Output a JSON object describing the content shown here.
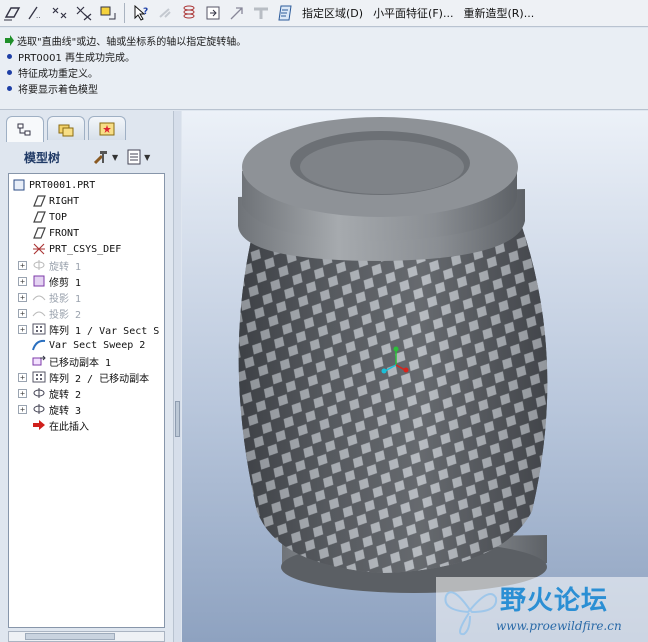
{
  "toolbar": {
    "icons": [
      "sketch-plane-icon",
      "sketch-line-icon",
      "sketch-points-icon",
      "sketch-axes-icon",
      "sketch-fit-icon",
      "help-pointer-icon",
      "disabled-tool-icon",
      "spring-feature-icon",
      "insert-icon",
      "arrow-tool-icon",
      "flat-tool-icon",
      "document-edit-icon"
    ],
    "commands": [
      "指定区域(D)",
      "小平面特征(F)...",
      "重新造型(R)..."
    ]
  },
  "messages": [
    {
      "type": "prompt",
      "text": "选取\"直曲线\"或边、轴或坐标系的轴以指定旋转轴。"
    },
    {
      "type": "info",
      "text": "PRT0001 再生成功完成。"
    },
    {
      "type": "info",
      "text": "特征成功重定义。"
    },
    {
      "type": "info",
      "text": "将要显示着色模型"
    }
  ],
  "model_tree": {
    "title": "模型树",
    "tabs": [
      "tree-tab",
      "layers-tab",
      "favorites-tab"
    ],
    "nodes": [
      {
        "label": "PRT0001.PRT",
        "icon": "part-icon"
      },
      {
        "label": "RIGHT",
        "icon": "datum-plane-icon"
      },
      {
        "label": "TOP",
        "icon": "datum-plane-icon"
      },
      {
        "label": "FRONT",
        "icon": "datum-plane-icon"
      },
      {
        "label": "PRT_CSYS_DEF",
        "icon": "csys-icon"
      },
      {
        "label": "旋转 1",
        "icon": "revolve-icon",
        "dim": true
      },
      {
        "label": "修剪 1",
        "icon": "trim-icon"
      },
      {
        "label": "投影 1",
        "icon": "projection-icon",
        "dim": true
      },
      {
        "label": "投影 2",
        "icon": "projection-icon",
        "dim": true
      },
      {
        "label": "阵列 1 / Var Sect S",
        "icon": "pattern-icon"
      },
      {
        "label": "Var Sect Sweep 2",
        "icon": "sweep-icon"
      },
      {
        "label": "已移动副本 1",
        "icon": "moved-copy-icon"
      },
      {
        "label": "阵列 2 / 已移动副本",
        "icon": "pattern-icon"
      },
      {
        "label": "旋转 2",
        "icon": "revolve-icon"
      },
      {
        "label": "旋转 3",
        "icon": "revolve-icon"
      },
      {
        "label": "在此插入",
        "icon": "insert-here-arrow-icon"
      }
    ]
  },
  "watermark": {
    "brand": "野火论坛",
    "url": "www.proewildfire.cn"
  },
  "colors": {
    "viewport_top": "#ecf1f8",
    "viewport_bottom": "#8ea2c0",
    "model_gray": "#8c8f93",
    "watermark_blue": "#2b8fd4"
  }
}
